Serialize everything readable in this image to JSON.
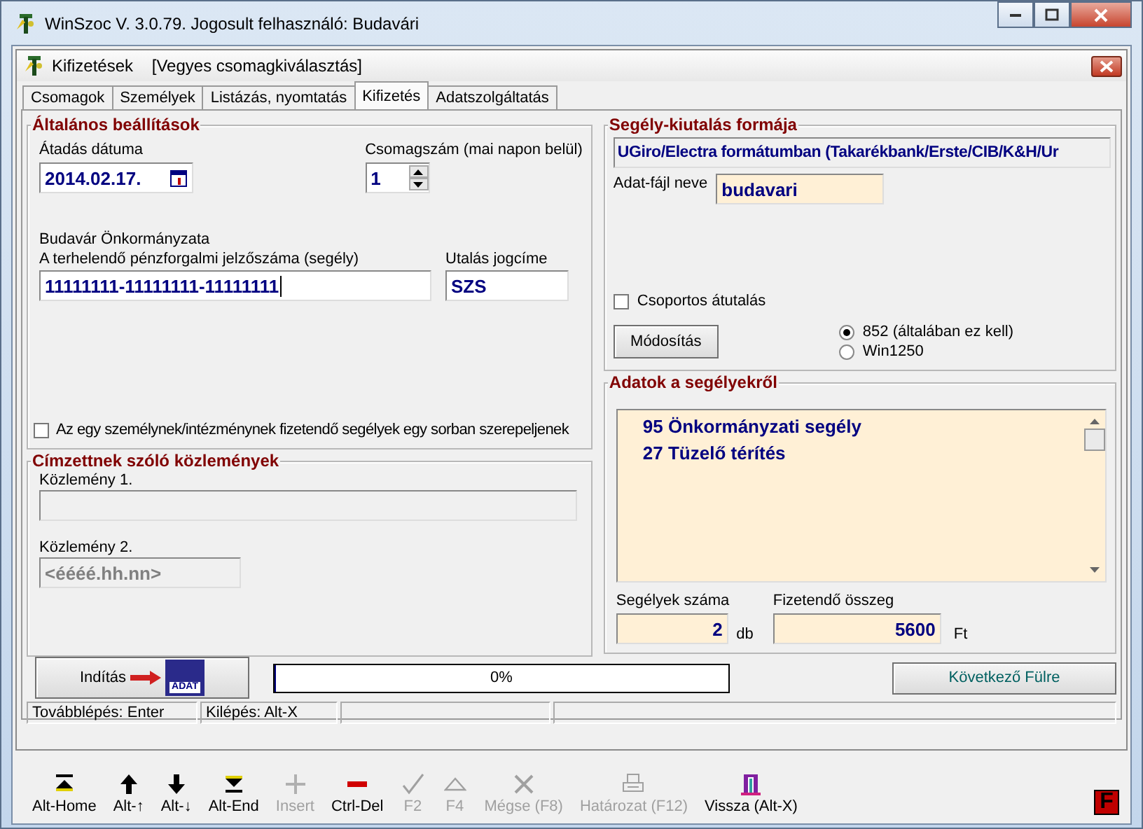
{
  "window": {
    "title": "WinSzoc V. 3.0.79. Jogosult felhasználó: Budavári"
  },
  "child_window": {
    "title": "Kifizetések",
    "subtitle": "[Vegyes csomagkiválasztás]"
  },
  "tabs": [
    {
      "label": "Csomagok",
      "selected": false
    },
    {
      "label": "Személyek",
      "selected": false
    },
    {
      "label": "Listázás, nyomtatás",
      "selected": false
    },
    {
      "label": "Kifizetés",
      "selected": true
    },
    {
      "label": "Adatszolgáltatás",
      "selected": false
    }
  ],
  "general": {
    "title": "Általános beállítások",
    "date_label": "Átadás dátuma",
    "date_value": "2014.02.17.",
    "package_label": "Csomagszám (mai napon belül)",
    "package_value": "1",
    "org_name": "Budavár Önkormányzata",
    "account_label": "A terhelendő pénzforgalmi jelzőszáma (segély)",
    "account_value": "11111111-11111111-11111111",
    "reason_label": "Utalás jogcíme",
    "reason_value": "SZS",
    "one_row": {
      "label": "Az egy személynek/intézménynek fizetendő segélyek egy sorban szerepeljenek",
      "checked": false
    }
  },
  "messages": {
    "title": "Címzettnek szóló közlemények",
    "fields": [
      {
        "label": "Közlemény 1.",
        "disabled": true
      },
      {
        "label": "Közlemény 2.",
        "value": "<éééé.hh.nn>",
        "disabled": true
      }
    ]
  },
  "transfer": {
    "title": "Segély-kiutalás formája",
    "format": "UGiro/Electra formátumban (Takarékbank/Erste/CIB/K&H/Ur",
    "file_label": "Adat-fájl neve",
    "file_value": "budavari",
    "group_transfer": {
      "label": "Csoportos átutalás",
      "checked": false
    },
    "modify_button": "Módosítás",
    "encodings": [
      {
        "label": "852 (általában ez kell)",
        "selected": true
      },
      {
        "label": "Win1250",
        "selected": false
      }
    ]
  },
  "aid_data": {
    "title": "Adatok a segélyekről",
    "items": [
      "95 Önkormányzati segély",
      "27 Tüzelő térítés"
    ],
    "count_label": "Segélyek száma",
    "count_value": "2",
    "count_unit": "db",
    "total_label": "Fizetendő összeg",
    "total_value": "5600",
    "total_unit": "Ft"
  },
  "start_button": {
    "label": "Indítás",
    "icon_text": "ADAT"
  },
  "progress": {
    "level": 0,
    "reading": "0%"
  },
  "next_button": "Következő Fülre",
  "status_bar": [
    "Továbblépés: Enter",
    "Kilépés: Alt-X"
  ],
  "toolbar": [
    {
      "label": "Alt-Home",
      "kind": "top",
      "disabled": false
    },
    {
      "label": "Alt-↑",
      "kind": "up",
      "disabled": false
    },
    {
      "label": "Alt-↓",
      "kind": "down",
      "disabled": false
    },
    {
      "label": "Alt-End",
      "kind": "bottom",
      "disabled": false
    },
    {
      "label": "Insert",
      "kind": "plus",
      "disabled": true
    },
    {
      "label": "Ctrl-Del",
      "kind": "minus",
      "disabled": false
    },
    {
      "label": "F2",
      "kind": "check",
      "disabled": true
    },
    {
      "label": "F4",
      "kind": "triangle",
      "disabled": true
    },
    {
      "label": "Mégse (F8)",
      "kind": "cross",
      "disabled": true
    },
    {
      "label": "Határozat (F12)",
      "kind": "printer",
      "disabled": true
    },
    {
      "label": "Vissza (Alt-X)",
      "kind": "door",
      "disabled": false
    }
  ],
  "indicator": "F"
}
